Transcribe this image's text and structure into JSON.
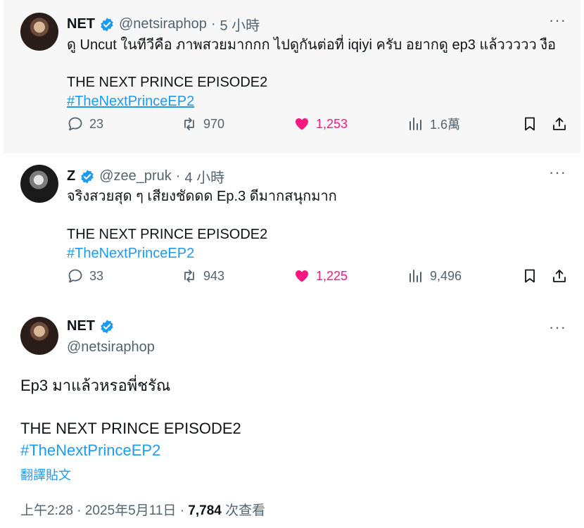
{
  "tweets": [
    {
      "name": "NET",
      "handle": "@netsiraphop",
      "time": "5 小時",
      "line1": "ดู Uncut ในทีวีคือ ภาพสวยมากกก ไปดูกันต่อที่ iqiyi ครับ อยากดู ep3 แล้ววววว งือ",
      "line2": "THE NEXT PRINCE EPISODE2",
      "hashtag": "#TheNextPrinceEP2",
      "replies": "23",
      "retweets": "970",
      "likes": "1,253",
      "views": "1.6萬"
    },
    {
      "name": "Z",
      "handle": "@zee_pruk",
      "time": "4 小時",
      "line1": "จริงสวยสุด ๆ เสียงชัดดด Ep.3 ดีมากสนุกมาก",
      "line2": "THE NEXT PRINCE EPISODE2",
      "hashtag": "#TheNextPrinceEP2",
      "replies": "33",
      "retweets": "943",
      "likes": "1,225",
      "views": "9,496"
    }
  ],
  "main": {
    "name": "NET",
    "handle": "@netsiraphop",
    "text": "Ep3 มาแล้วหรอพี่ชรัณ",
    "line2": "THE NEXT PRINCE EPISODE2",
    "hashtag": "#TheNextPrinceEP2",
    "translate": "翻譯貼文",
    "timestamp": "上午2:28 · 2025年5月11日 · ",
    "views_count": "7,784",
    "views_label": " 次查看"
  },
  "ui": {
    "separator": "·",
    "more": "···"
  },
  "colors": {
    "accent": "#1d9bf0",
    "like": "#f91880",
    "muted": "#536471"
  }
}
